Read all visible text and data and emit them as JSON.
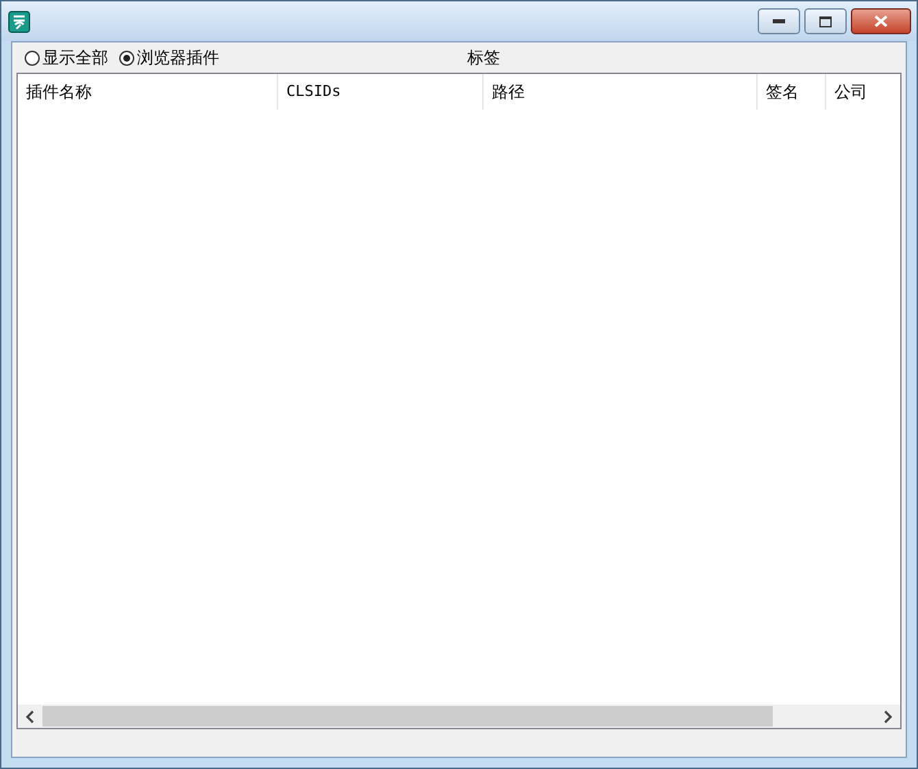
{
  "filters": [
    {
      "label": "显示全部",
      "selected": false
    },
    {
      "label": "浏览器插件",
      "selected": true
    }
  ],
  "tag_label": "标签",
  "table": {
    "columns": [
      "插件名称",
      "CLSIDs",
      "路径",
      "签名",
      "公司"
    ]
  }
}
